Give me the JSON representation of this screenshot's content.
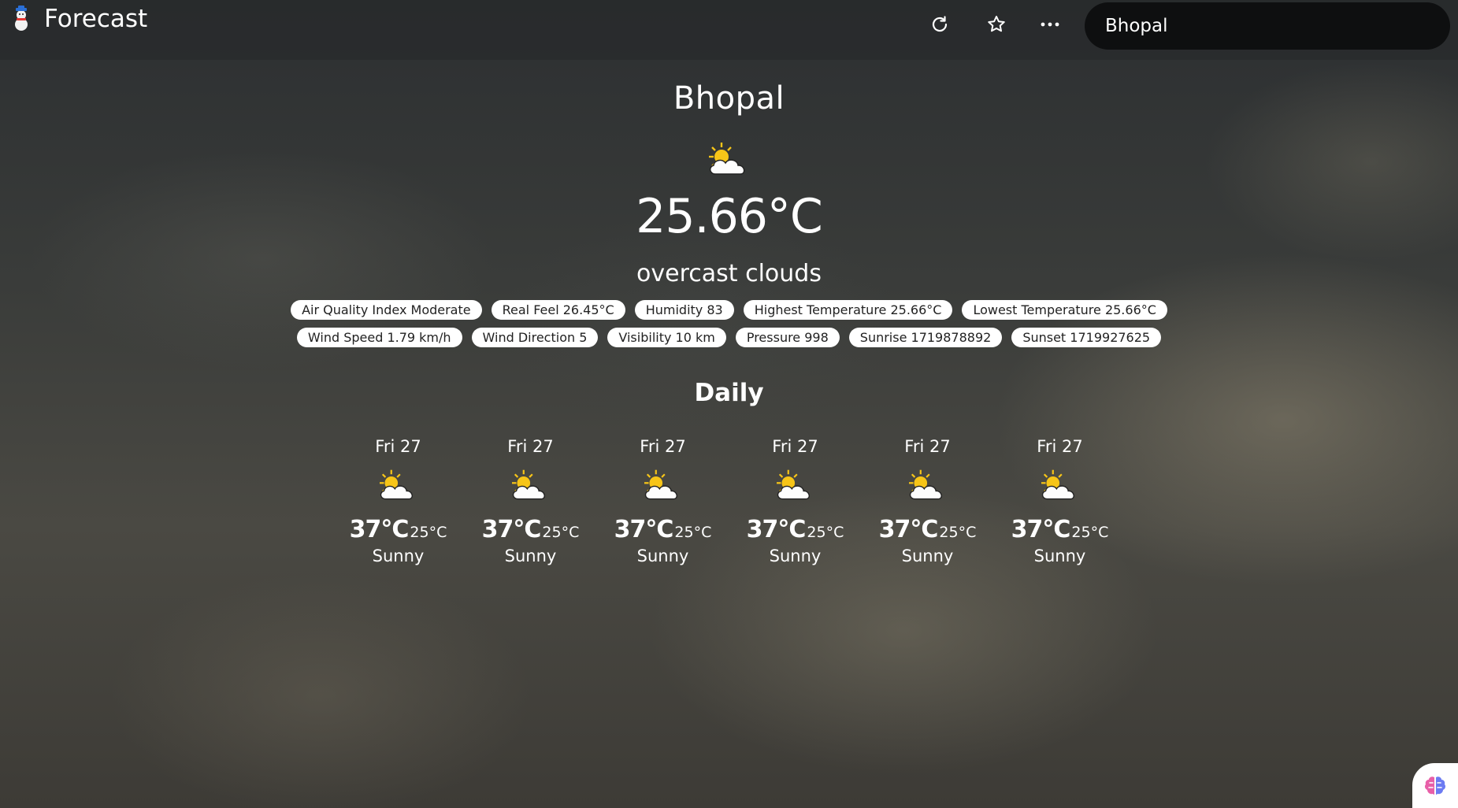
{
  "app": {
    "title": "Forecast"
  },
  "toolbar": {
    "refresh_icon": "refresh-icon",
    "favorite_icon": "star-icon",
    "more_icon": "more-icon"
  },
  "search": {
    "value": "Bhopal",
    "placeholder": ""
  },
  "current": {
    "city": "Bhopal",
    "temperature": "25.66°C",
    "description": "overcast clouds",
    "icon": "partly-cloudy-icon"
  },
  "details": [
    "Air Quality Index Moderate",
    "Real Feel 26.45°C",
    "Humidity 83",
    "Highest Temperature 25.66°C",
    "Lowest Temperature 25.66°C",
    "Wind Speed 1.79 km/h",
    "Wind Direction 5",
    "Visibility 10 km",
    "Pressure 998",
    "Sunrise 1719878892",
    "Sunset 1719927625"
  ],
  "daily": {
    "title": "Daily",
    "days": [
      {
        "date": "Fri 27",
        "high": "37°C",
        "low": "25°C",
        "condition": "Sunny"
      },
      {
        "date": "Fri 27",
        "high": "37°C",
        "low": "25°C",
        "condition": "Sunny"
      },
      {
        "date": "Fri 27",
        "high": "37°C",
        "low": "25°C",
        "condition": "Sunny"
      },
      {
        "date": "Fri 27",
        "high": "37°C",
        "low": "25°C",
        "condition": "Sunny"
      },
      {
        "date": "Fri 27",
        "high": "37°C",
        "low": "25°C",
        "condition": "Sunny"
      },
      {
        "date": "Fri 27",
        "high": "37°C",
        "low": "25°C",
        "condition": "Sunny"
      }
    ]
  },
  "assistant_icon": "brain-icon",
  "colors": {
    "topbar": "#2a2c2e",
    "search_bg": "#0e0f10",
    "pill_bg": "#ffffff",
    "sun": "#f7c518"
  }
}
